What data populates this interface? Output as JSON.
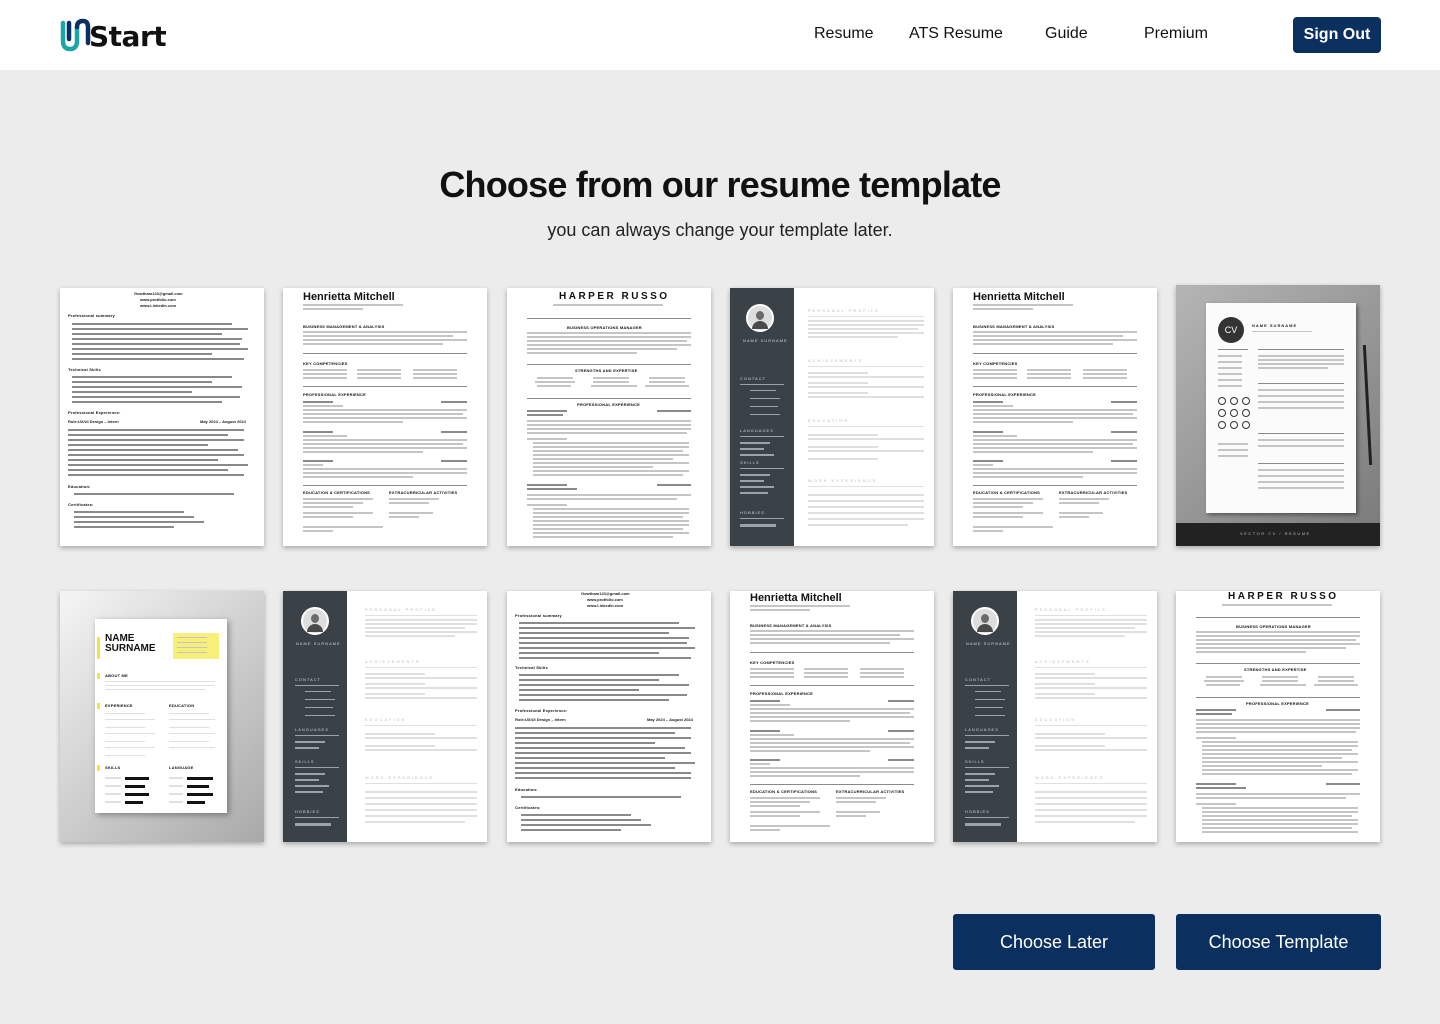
{
  "brand": {
    "name": "Start",
    "accent": "#0b3060",
    "logo_color": "#1ba6a6"
  },
  "nav": {
    "links": [
      "Resume",
      "ATS Resume",
      "Guide",
      "Premium"
    ],
    "signout": "Sign Out"
  },
  "heading": "Choose from our resume template",
  "subheading": "you can always change your template later.",
  "templates": {
    "t1": {
      "lines": [
        "Gowtham123@gmail.com",
        "www.protfolio.com",
        "www.Linkedln.com"
      ],
      "sections": [
        "Professional summary",
        "Technical Skills",
        "Professional Experience:",
        "Education:",
        "Certificates:"
      ],
      "role": "Role:UX/UI Design – Intern",
      "dates": "May 2024 – August 2024"
    },
    "t2": {
      "name": "Henrietta Mitchell",
      "sections": [
        "BUSINESS MANAGEMENT & ANALYSIS",
        "KEY COMPETENCIES",
        "PROFESSIONAL EXPERIENCE",
        "EDUCATION & CERTIFICATIONS",
        "EXTRACURRICULAR ACTIVITIES"
      ]
    },
    "t3": {
      "name": "HARPER RUSSO",
      "sections": [
        "BUSINESS OPERATIONS MANAGER",
        "STRENGTHS AND EXPERTISE",
        "PROFESSIONAL EXPERIENCE"
      ]
    },
    "t4": {
      "name": "NAME SURNAME",
      "side": [
        "CONTACT",
        "LANGUAGES",
        "SKILLS",
        "HOBBIES"
      ],
      "main": [
        "PERSONAL PROFILE",
        "ACHIEVEMENTS",
        "EDUCATION",
        "WORK EXPERIENCE"
      ]
    },
    "t6": {
      "initials": "CV",
      "name": "NAME SURNAME",
      "footer": "VECTOR CV / RESUME"
    },
    "t7": {
      "name_line1": "NAME",
      "name_line2": "SURNAME",
      "sections": [
        "ABOUT ME",
        "EXPERIENCE",
        "EDUCATION",
        "SKILLS",
        "LANGUAGE"
      ]
    }
  },
  "actions": {
    "later": "Choose Later",
    "choose": "Choose Template"
  }
}
